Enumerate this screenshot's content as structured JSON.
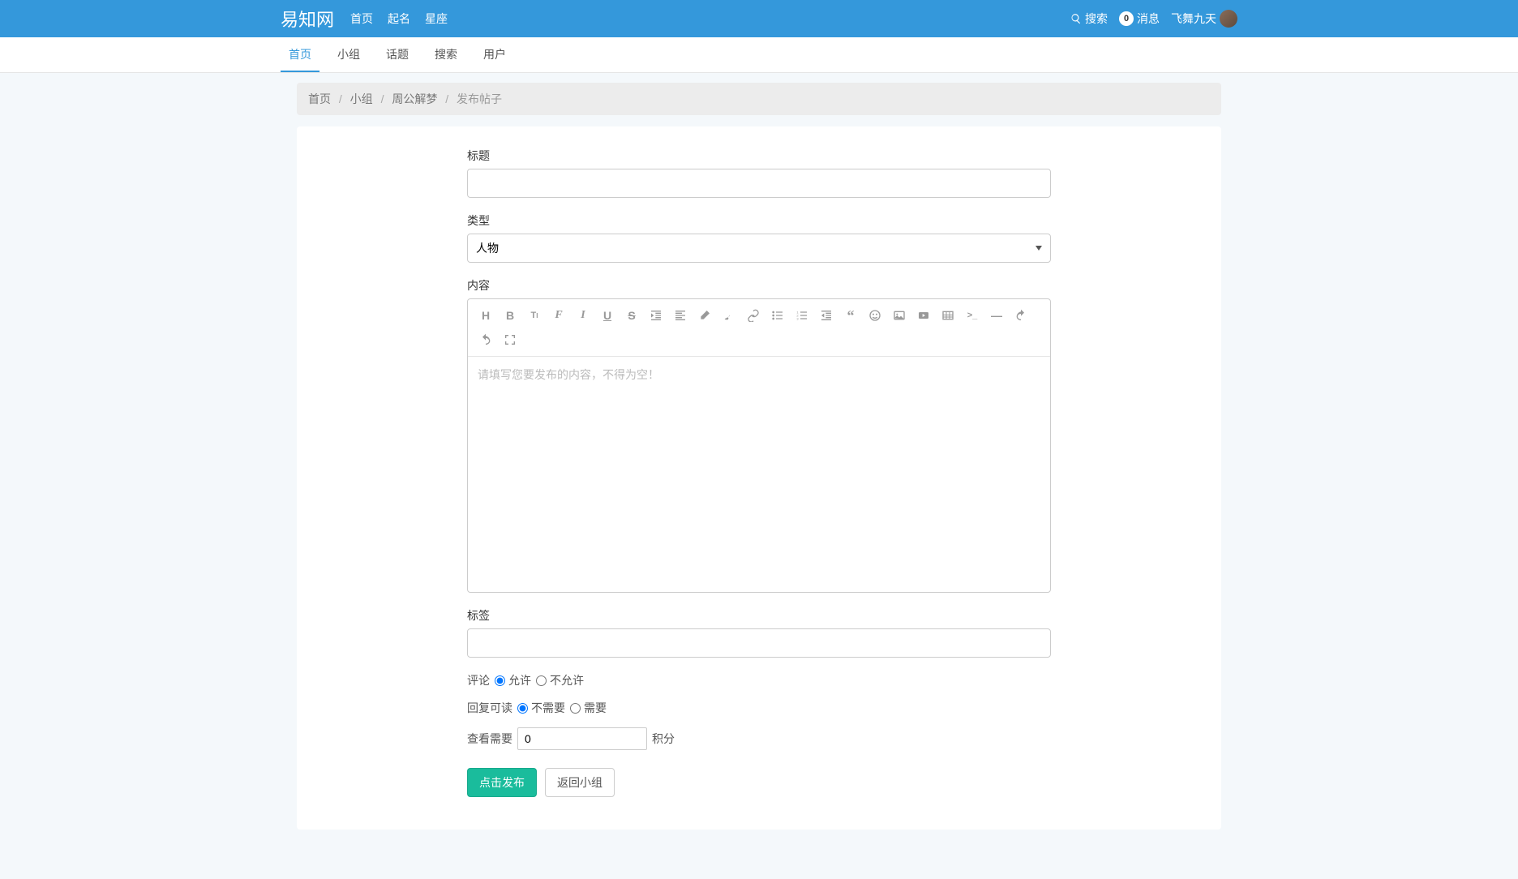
{
  "header": {
    "logo": "易知网",
    "nav": [
      "首页",
      "起名",
      "星座"
    ],
    "search_label": "搜索",
    "msg_count": "0",
    "msg_label": "消息",
    "username": "飞舞九天"
  },
  "sub_tabs": [
    "首页",
    "小组",
    "话题",
    "搜索",
    "用户"
  ],
  "breadcrumb": {
    "items": [
      "首页",
      "小组",
      "周公解梦"
    ],
    "current": "发布帖子"
  },
  "form": {
    "title_label": "标题",
    "type_label": "类型",
    "type_selected": "人物",
    "content_label": "内容",
    "content_placeholder": "请填写您要发布的内容，不得为空！",
    "tags_label": "标签",
    "comment_label": "评论",
    "comment_options": [
      "允许",
      "不允许"
    ],
    "reply_label": "回复可读",
    "reply_options": [
      "不需要",
      "需要"
    ],
    "points_prefix": "查看需要",
    "points_value": "0",
    "points_suffix": "积分",
    "submit_btn": "点击发布",
    "back_btn": "返回小组"
  },
  "toolbar_icons": [
    "heading-icon",
    "bold-icon",
    "fontsize-icon",
    "fontfamily-icon",
    "italic-icon",
    "underline-icon",
    "strikethrough-icon",
    "indent-icon",
    "align-icon",
    "eraser-icon",
    "brush-icon",
    "link-icon",
    "unordered-list-icon",
    "ordered-list-icon",
    "quote-icon",
    "emoji-icon",
    "image-icon",
    "video-icon",
    "table-icon",
    "code-icon",
    "hr-icon",
    "undo-icon",
    "redo-icon",
    "fullscreen-icon"
  ]
}
